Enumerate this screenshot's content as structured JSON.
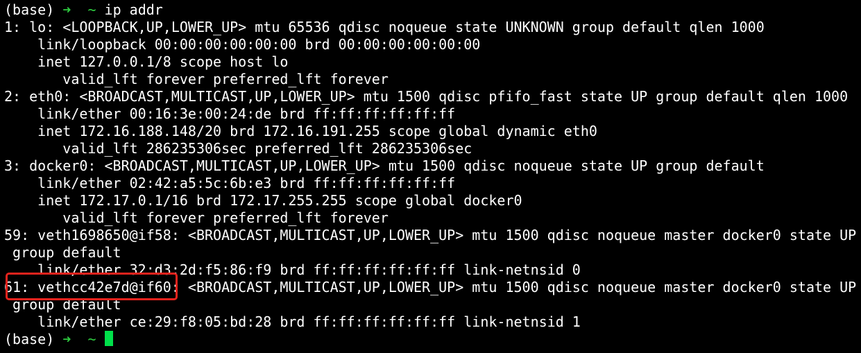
{
  "prompt": {
    "env": "(base)",
    "arrow": "➜",
    "dir": "~",
    "command": "ip addr"
  },
  "output_lines": [
    "1: lo: <LOOPBACK,UP,LOWER_UP> mtu 65536 qdisc noqueue state UNKNOWN group default qlen 1000",
    "    link/loopback 00:00:00:00:00:00 brd 00:00:00:00:00:00",
    "    inet 127.0.0.1/8 scope host lo",
    "       valid_lft forever preferred_lft forever",
    "2: eth0: <BROADCAST,MULTICAST,UP,LOWER_UP> mtu 1500 qdisc pfifo_fast state UP group default qlen 1000",
    "    link/ether 00:16:3e:00:24:de brd ff:ff:ff:ff:ff:ff",
    "    inet 172.16.188.148/20 brd 172.16.191.255 scope global dynamic eth0",
    "       valid_lft 286235306sec preferred_lft 286235306sec",
    "3: docker0: <BROADCAST,MULTICAST,UP,LOWER_UP> mtu 1500 qdisc noqueue state UP group default",
    "    link/ether 02:42:a5:5c:6b:e3 brd ff:ff:ff:ff:ff:ff",
    "    inet 172.17.0.1/16 brd 172.17.255.255 scope global docker0",
    "       valid_lft forever preferred_lft forever",
    "59: veth1698650@if58: <BROADCAST,MULTICAST,UP,LOWER_UP> mtu 1500 qdisc noqueue master docker0 state UP",
    " group default",
    "    link/ether 32:d3:2d:f5:86:f9 brd ff:ff:ff:ff:ff:ff link-netnsid 0",
    "61: vethcc42e7d@if60: <BROADCAST,MULTICAST,UP,LOWER_UP> mtu 1500 qdisc noqueue master docker0 state UP",
    " group default",
    "    link/ether ce:29:f8:05:bd:28 brd ff:ff:ff:ff:ff:ff link-netnsid 1"
  ],
  "colors": {
    "background": "#000000",
    "text": "#ffffff",
    "prompt_arrow": "#2ecc40",
    "cursor": "#00e04a",
    "highlight_box": "#e8231d"
  }
}
